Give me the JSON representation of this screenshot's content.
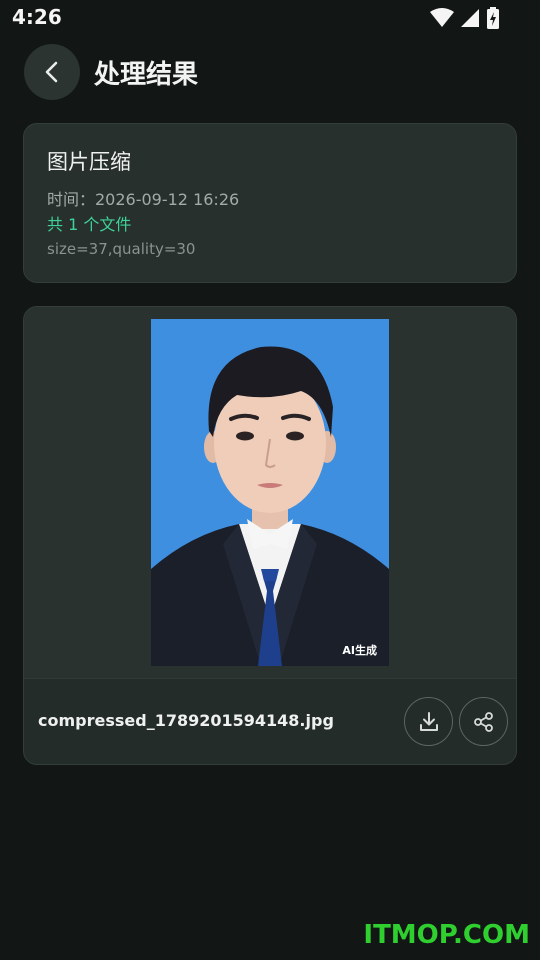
{
  "status_bar": {
    "time": "4:26"
  },
  "header": {
    "title": "处理结果"
  },
  "info_card": {
    "title": "图片压缩",
    "time_text": "时间：2026-09-12 16:26",
    "count_text": "共 1 个文件",
    "params_text": "size=37,quality=30"
  },
  "result_card": {
    "photo_badge": "AI生成",
    "file_name": "compressed_1789201594148.jpg"
  },
  "watermark": "ITMOP.COM",
  "colors": {
    "background": "#121615",
    "card": "#27302d",
    "accent_green": "#3ed39a",
    "photo_background": "#3f8fe0",
    "watermark": "#2fcf2f"
  }
}
